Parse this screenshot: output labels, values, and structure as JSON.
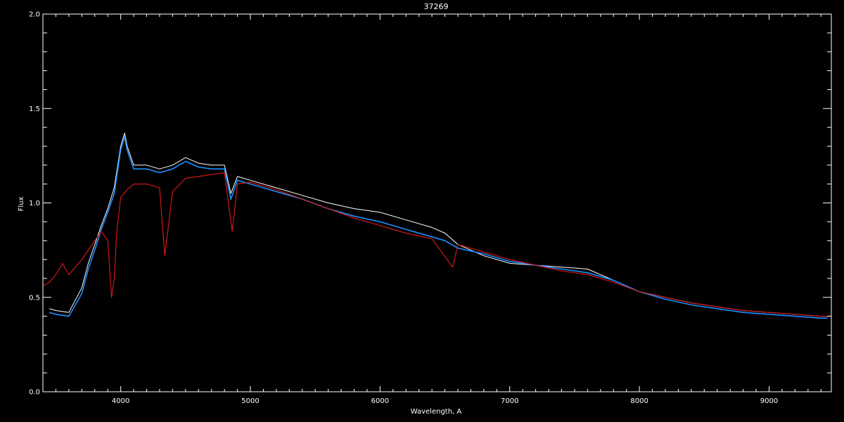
{
  "chart_data": {
    "type": "line",
    "title": "37269",
    "xlabel": "Wavelength, A",
    "ylabel": "Flux",
    "xlim": [
      3400,
      9480
    ],
    "ylim": [
      0.0,
      2.0
    ],
    "x_ticks": [
      4000,
      5000,
      6000,
      7000,
      8000,
      9000
    ],
    "y_ticks": [
      0.0,
      0.5,
      1.0,
      1.5,
      2.0
    ],
    "y_tick_labels": [
      "0.0",
      "0.5",
      "1.0",
      "1.5",
      "2.0"
    ],
    "grid": false,
    "colors": {
      "background": "#000000",
      "axes": "#ffffff",
      "white_spectrum": "#ffffff",
      "blue_spectrum": "#1e8fff",
      "red_model": "#d01818"
    },
    "series": [
      {
        "color": "#ffffff",
        "x": [
          3450,
          3500,
          3600,
          3700,
          3750,
          3800,
          3850,
          3900,
          3950,
          4000,
          4030,
          4050,
          4100,
          4200,
          4300,
          4400,
          4500,
          4600,
          4700,
          4800,
          4850,
          4900,
          5000,
          5200,
          5400,
          5600,
          5800,
          6000,
          6200,
          6400,
          6500,
          6600,
          6800,
          7000,
          7200,
          7400,
          7600,
          7700,
          7800,
          8000,
          8200,
          8400,
          8600,
          8800,
          9000,
          9200,
          9400,
          9450
        ],
        "y": [
          0.44,
          0.43,
          0.42,
          0.55,
          0.68,
          0.78,
          0.88,
          0.97,
          1.08,
          1.3,
          1.37,
          1.3,
          1.2,
          1.2,
          1.18,
          1.2,
          1.24,
          1.21,
          1.2,
          1.2,
          1.05,
          1.14,
          1.12,
          1.08,
          1.04,
          1.0,
          0.97,
          0.95,
          0.91,
          0.87,
          0.84,
          0.78,
          0.72,
          0.68,
          0.67,
          0.66,
          0.65,
          0.62,
          0.59,
          0.53,
          0.5,
          0.47,
          0.45,
          0.43,
          0.42,
          0.41,
          0.4,
          0.4
        ]
      },
      {
        "color": "#1e8fff",
        "x": [
          3450,
          3500,
          3600,
          3700,
          3750,
          3800,
          3850,
          3900,
          3950,
          4000,
          4030,
          4050,
          4100,
          4200,
          4300,
          4400,
          4500,
          4600,
          4700,
          4800,
          4850,
          4900,
          5000,
          5200,
          5400,
          5600,
          5800,
          6000,
          6200,
          6400,
          6500,
          6600,
          6800,
          7000,
          7200,
          7400,
          7600,
          7700,
          7800,
          8000,
          8200,
          8400,
          8600,
          8800,
          9000,
          9200,
          9400,
          9450
        ],
        "y": [
          0.42,
          0.41,
          0.4,
          0.52,
          0.65,
          0.75,
          0.86,
          0.95,
          1.05,
          1.28,
          1.35,
          1.28,
          1.18,
          1.18,
          1.16,
          1.18,
          1.22,
          1.19,
          1.18,
          1.18,
          1.02,
          1.12,
          1.1,
          1.06,
          1.02,
          0.97,
          0.93,
          0.9,
          0.86,
          0.82,
          0.8,
          0.76,
          0.73,
          0.69,
          0.67,
          0.65,
          0.63,
          0.61,
          0.59,
          0.53,
          0.49,
          0.46,
          0.44,
          0.42,
          0.41,
          0.4,
          0.39,
          0.39
        ]
      },
      {
        "color": "#d01818",
        "x": [
          3400,
          3450,
          3500,
          3550,
          3600,
          3650,
          3700,
          3750,
          3800,
          3850,
          3900,
          3930,
          3950,
          3970,
          4000,
          4050,
          4100,
          4200,
          4300,
          4340,
          4400,
          4500,
          4600,
          4700,
          4800,
          4860,
          4900,
          5000,
          5200,
          5400,
          5600,
          5800,
          6000,
          6200,
          6400,
          6560,
          6600,
          6800,
          7000,
          7200,
          7400,
          7600,
          7800,
          8000,
          8200,
          8400,
          8600,
          8800,
          9000,
          9200,
          9400,
          9480
        ],
        "y": [
          0.56,
          0.58,
          0.62,
          0.68,
          0.62,
          0.66,
          0.7,
          0.75,
          0.8,
          0.85,
          0.8,
          0.5,
          0.6,
          0.85,
          1.03,
          1.07,
          1.1,
          1.1,
          1.08,
          0.72,
          1.06,
          1.13,
          1.14,
          1.15,
          1.16,
          0.85,
          1.1,
          1.11,
          1.07,
          1.02,
          0.97,
          0.92,
          0.88,
          0.84,
          0.81,
          0.66,
          0.78,
          0.74,
          0.7,
          0.67,
          0.64,
          0.62,
          0.58,
          0.53,
          0.5,
          0.47,
          0.45,
          0.43,
          0.42,
          0.41,
          0.4,
          0.4
        ]
      }
    ]
  }
}
